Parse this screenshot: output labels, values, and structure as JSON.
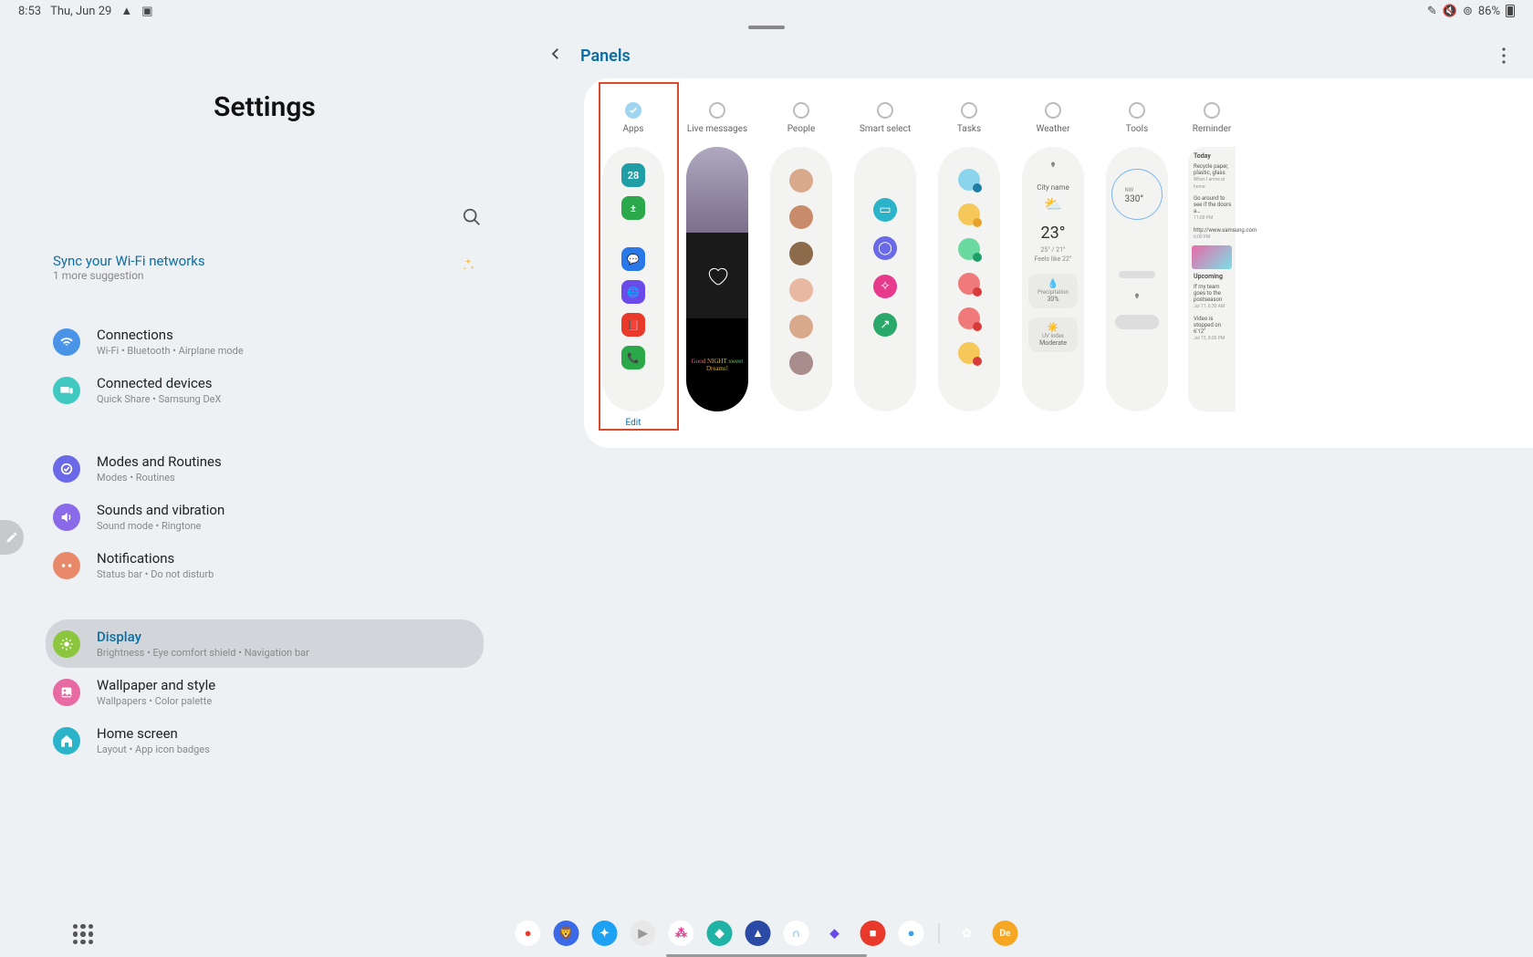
{
  "status": {
    "time": "8:53",
    "date": "Thu, Jun 29",
    "battery": "86%"
  },
  "settings": {
    "title": "Settings",
    "suggestion": {
      "title": "Sync your Wi-Fi networks",
      "subtitle": "1 more suggestion"
    },
    "items": [
      {
        "label": "Connections",
        "sub": "Wi-Fi • Bluetooth • Airplane mode",
        "color": "#4a94e8"
      },
      {
        "label": "Connected devices",
        "sub": "Quick Share • Samsung DeX",
        "color": "#3fc9c1"
      },
      {
        "label": "Modes and Routines",
        "sub": "Modes • Routines",
        "color": "#6a6ae8"
      },
      {
        "label": "Sounds and vibration",
        "sub": "Sound mode • Ringtone",
        "color": "#8a6ae8"
      },
      {
        "label": "Notifications",
        "sub": "Status bar • Do not disturb",
        "color": "#e88a6a"
      },
      {
        "label": "Display",
        "sub": "Brightness • Eye comfort shield • Navigation bar",
        "color": "#8cc63f",
        "selected": true
      },
      {
        "label": "Wallpaper and style",
        "sub": "Wallpapers • Color palette",
        "color": "#e86aa3"
      },
      {
        "label": "Home screen",
        "sub": "Layout • App icon badges",
        "color": "#2bb3c9"
      }
    ]
  },
  "panels": {
    "title": "Panels",
    "edit": "Edit",
    "list": [
      {
        "name": "Apps",
        "checked": true
      },
      {
        "name": "Live messages",
        "checked": false
      },
      {
        "name": "People",
        "checked": false
      },
      {
        "name": "Smart select",
        "checked": false
      },
      {
        "name": "Tasks",
        "checked": false
      },
      {
        "name": "Weather",
        "checked": false
      },
      {
        "name": "Tools",
        "checked": false
      },
      {
        "name": "Reminder",
        "checked": false
      }
    ],
    "apps_preview": [
      {
        "bg": "#1f9ea6",
        "txt": "28"
      },
      {
        "bg": "#2aa84a",
        "txt": "±"
      },
      {
        "bg": "#2a78e8",
        "txt": "💬"
      },
      {
        "bg": "#6a4ae8",
        "txt": "🌐"
      },
      {
        "bg": "#e8392a",
        "txt": "📕"
      },
      {
        "bg": "#2aa84a",
        "txt": "📞"
      }
    ],
    "live_msg_text": "Good NIGHT sweet Dreams!",
    "people_colors": [
      "#d9a98c",
      "#c98c6a",
      "#8c6a4a",
      "#e8b8a0",
      "#d9a98c",
      "#a98c8c"
    ],
    "smart_select": [
      {
        "bg": "#2bb3c9"
      },
      {
        "bg": "#6a6ae8"
      },
      {
        "bg": "#e83a8c"
      },
      {
        "bg": "#2aa86a"
      }
    ],
    "tasks": [
      {
        "main": "#8bd4ee",
        "dot": "#1f7ea6"
      },
      {
        "main": "#f6c85a",
        "dot": "#e8a22a"
      },
      {
        "main": "#6ad99f",
        "dot": "#1f9e6a"
      },
      {
        "main": "#f07a7a",
        "dot": "#d93a3a"
      },
      {
        "main": "#f07a7a",
        "dot": "#d93a3a"
      },
      {
        "main": "#f6c85a",
        "dot": "#d93a3a"
      }
    ],
    "weather": {
      "city": "City name",
      "temp": "23°",
      "sub": "25° / 21°\nFeels like 22°",
      "precip_l": "Precipitation",
      "precip_v": "30%",
      "uv_l": "UV Index",
      "uv_v": "Moderate"
    },
    "tools": {
      "heading": "330°",
      "prefix": "NW"
    },
    "reminder": {
      "today": "Today",
      "items": [
        {
          "t": "Recycle paper, plastic, glass",
          "s": "When I arrive at home"
        },
        {
          "t": "Go around to see if the doors a…",
          "s": "11:00 PM"
        },
        {
          "t": "http://www.samsung.com",
          "s": "6:00 PM"
        }
      ],
      "upcoming": "Upcoming",
      "up_items": [
        {
          "t": "If my team goes to the postseason",
          "s": "Jul 11, 6:30 AM"
        },
        {
          "t": "Video is stopped on 6'12\"",
          "s": "Jul 15, 8:00 PM"
        }
      ]
    }
  },
  "dock": [
    {
      "bg": "#fff",
      "fg": "#e8392a",
      "txt": "●"
    },
    {
      "bg": "#3a6ae8",
      "txt": "🦁"
    },
    {
      "bg": "#1da1f2",
      "txt": "✦"
    },
    {
      "bg": "#e8e8e8",
      "fg": "#999",
      "txt": "▶"
    },
    {
      "bg": "#fff",
      "fg": "#e83a8c",
      "txt": "⁂"
    },
    {
      "bg": "#1fb3a6",
      "txt": "◆"
    },
    {
      "bg": "#2a4aa6",
      "txt": "▲"
    },
    {
      "bg": "#fff",
      "fg": "#3a9ee8",
      "txt": "∩"
    },
    {
      "bg": "transparent",
      "fg": "#6a4ae8",
      "txt": "◆"
    },
    {
      "bg": "#e8392a",
      "txt": "■"
    },
    {
      "bg": "#fff",
      "fg": "#3a9ee8",
      "txt": "●"
    }
  ],
  "dock2": [
    {
      "bg": "transparent",
      "txt": "✿"
    },
    {
      "bg": "#f5a623",
      "txt": "De"
    }
  ]
}
